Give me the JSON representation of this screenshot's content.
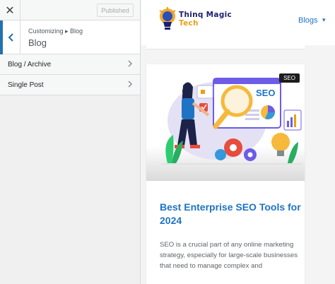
{
  "customizer": {
    "close_label": "✕",
    "publish_label": "Published",
    "breadcrumb": "Customizing ▸ Blog",
    "section_title": "Blog",
    "items": [
      {
        "label": "Blog / Archive"
      },
      {
        "label": "Single Post"
      }
    ]
  },
  "site": {
    "logo_line1": "Thinq Magic",
    "logo_line2": "Tech",
    "nav": {
      "label": "Blogs",
      "caret": "▾"
    }
  },
  "post": {
    "badge": "SEO",
    "illustration_label": "SEO",
    "title": "Best Enterprise SEO Tools for 2024",
    "excerpt": "SEO is a crucial part of any online marketing strategy, especially for large-scale businesses that need to manage complex and"
  },
  "colors": {
    "accent": "#2271b1",
    "link": "#1f73c4",
    "brand_navy": "#1a1f6e",
    "brand_gold": "#e6a11a"
  }
}
